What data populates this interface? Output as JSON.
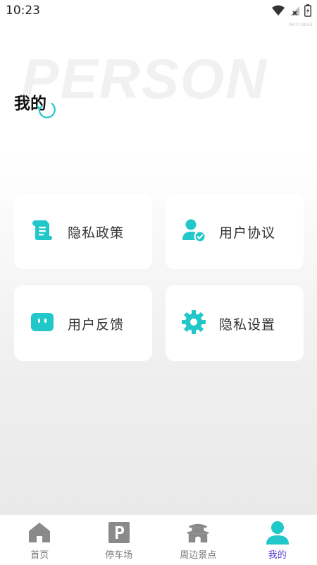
{
  "status_bar": {
    "time": "10:23",
    "device_id": "6e7c46a3"
  },
  "header": {
    "background_word": "PERSON",
    "title": "我的"
  },
  "cards": [
    {
      "label": "隐私政策",
      "icon": "scroll-icon"
    },
    {
      "label": "用户协议",
      "icon": "user-shield-icon"
    },
    {
      "label": "用户反馈",
      "icon": "chat-box-icon"
    },
    {
      "label": "隐私设置",
      "icon": "gear-icon"
    }
  ],
  "tabbar": {
    "items": [
      {
        "label": "首页",
        "icon": "home-icon",
        "active": false
      },
      {
        "label": "停车场",
        "icon": "parking-icon",
        "active": false
      },
      {
        "label": "周边景点",
        "icon": "landmark-icon",
        "active": false
      },
      {
        "label": "我的",
        "icon": "person-icon",
        "active": true
      }
    ]
  },
  "colors": {
    "accent": "#22c7c9",
    "tab_inactive": "#8a8a8a",
    "tab_active_label": "#5b3fd0"
  }
}
